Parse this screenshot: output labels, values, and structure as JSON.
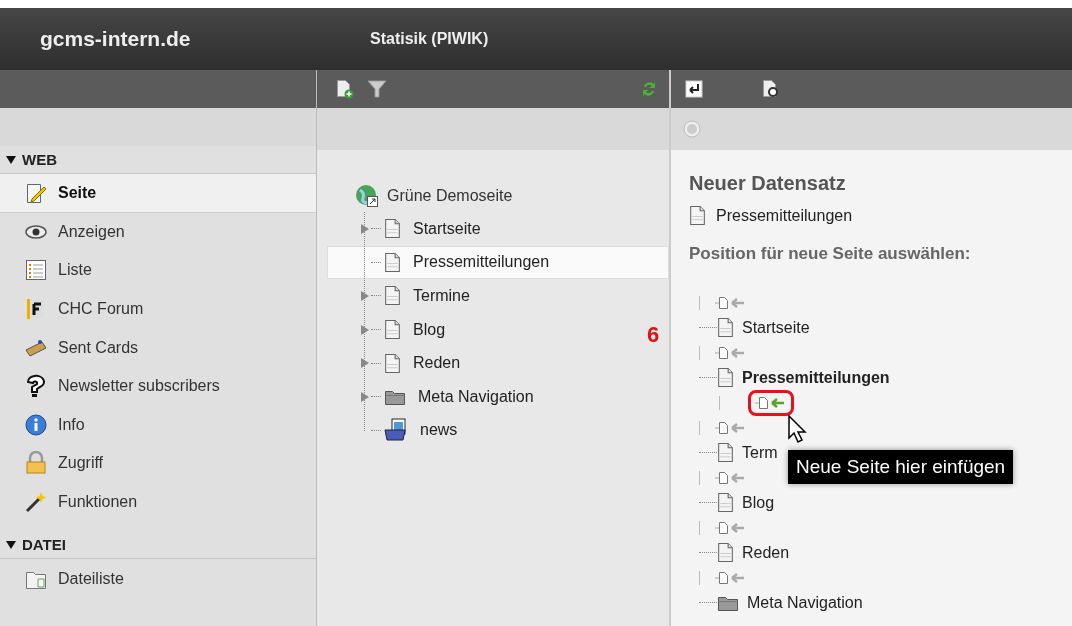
{
  "header": {
    "site_title": "gcms-intern.de",
    "module_title": "Statisik (PIWIK)"
  },
  "sidebar": {
    "sections": [
      {
        "label": "WEB",
        "expanded": true,
        "items": [
          {
            "label": "Seite",
            "selected": true
          },
          {
            "label": "Anzeigen",
            "selected": false
          },
          {
            "label": "Liste",
            "selected": false
          },
          {
            "label": "CHC Forum",
            "selected": false
          },
          {
            "label": "Sent Cards",
            "selected": false
          },
          {
            "label": "Newsletter subscribers",
            "selected": false
          },
          {
            "label": "Info",
            "selected": false
          },
          {
            "label": "Zugriff",
            "selected": false
          },
          {
            "label": "Funktionen",
            "selected": false
          }
        ]
      },
      {
        "label": "DATEI",
        "expanded": true,
        "items": [
          {
            "label": "Dateiliste",
            "selected": false
          }
        ]
      }
    ]
  },
  "page_tree": {
    "root": "Grüne Demoseite",
    "children": [
      {
        "label": "Startseite",
        "kind": "page",
        "has_children": true,
        "selected": false
      },
      {
        "label": "Pressemitteilungen",
        "kind": "page",
        "has_children": false,
        "selected": true
      },
      {
        "label": "Termine",
        "kind": "page",
        "has_children": true,
        "selected": false
      },
      {
        "label": "Blog",
        "kind": "page",
        "has_children": true,
        "selected": false
      },
      {
        "label": "Reden",
        "kind": "page",
        "has_children": true,
        "selected": false
      },
      {
        "label": "Meta Navigation",
        "kind": "folder",
        "has_children": true,
        "selected": false
      },
      {
        "label": "news",
        "kind": "news",
        "has_children": false,
        "selected": false
      }
    ]
  },
  "callout": {
    "number": "6"
  },
  "content": {
    "heading": "Neuer Datensatz",
    "record": "Pressemitteilungen",
    "prompt": "Position für neue Seite auswählen:",
    "positions": [
      {
        "kind": "marker",
        "hovered": false
      },
      {
        "kind": "page",
        "label": "Startseite",
        "current": false
      },
      {
        "kind": "marker",
        "hovered": false
      },
      {
        "kind": "page",
        "label": "Pressemitteilungen",
        "current": true,
        "children": [
          {
            "kind": "marker",
            "hovered": true
          }
        ]
      },
      {
        "kind": "marker",
        "hovered": false
      },
      {
        "kind": "page",
        "label": "Term",
        "current": false
      },
      {
        "kind": "marker",
        "hovered": false
      },
      {
        "kind": "page",
        "label": "Blog",
        "current": false
      },
      {
        "kind": "marker",
        "hovered": false
      },
      {
        "kind": "page",
        "label": "Reden",
        "current": false
      },
      {
        "kind": "marker",
        "hovered": false
      },
      {
        "kind": "folder",
        "label": "Meta Navigation",
        "current": false
      }
    ],
    "tooltip": "Neue Seite hier einfügen"
  }
}
